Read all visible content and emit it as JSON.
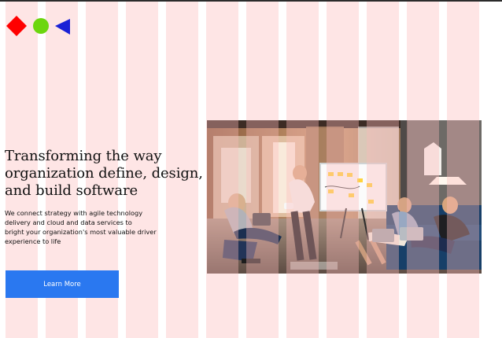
{
  "logo": {
    "shapes": [
      "diamond",
      "circle",
      "triangle"
    ],
    "colors": {
      "diamond": "#ff0000",
      "circle": "#6cd60e",
      "triangle": "#1a21d6"
    }
  },
  "hero": {
    "title_lines": [
      "Transforming the way",
      "organization define, design,",
      "and build software"
    ],
    "subtitle_lines": [
      "We connect strategy with agile technology",
      "delivery and cloud and data services to",
      "bright your organization's most valuable driver",
      "experience to life"
    ],
    "cta_label": "Learn More"
  },
  "image": {
    "description_icon": "team-meeting-photo"
  },
  "colors": {
    "accent": "#2a78f0",
    "grid_overlay": "#fcbaba",
    "text": "#111111",
    "background": "#ffffff"
  }
}
